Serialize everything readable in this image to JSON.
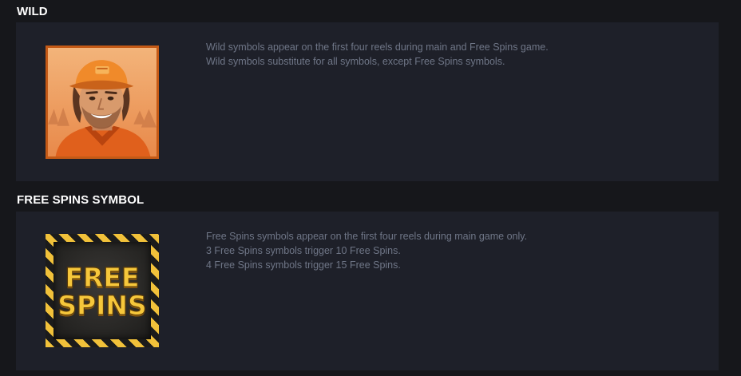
{
  "sections": {
    "wild": {
      "title": "WILD",
      "lines": [
        "Wild symbols appear on the first four reels during main and Free Spins game.",
        "Wild symbols substitute for all symbols, except Free Spins symbols."
      ],
      "symbol_icon": "wild-man-portrait-icon"
    },
    "free_spins": {
      "title": "FREE SPINS SYMBOL",
      "lines": [
        "Free Spins symbols appear on the first four reels during main game only.",
        "3 Free Spins symbols trigger 10 Free Spins.",
        "4 Free Spins symbols trigger 15 Free Spins."
      ],
      "symbol_text_line1": "FREE",
      "symbol_text_line2": "SPINS",
      "symbol_icon": "free-spins-symbol-icon"
    }
  },
  "colors": {
    "background": "#16171b",
    "panel": "#1e2029",
    "description_text": "#6f7687",
    "title_text": "#ffffff",
    "free_spins_gold": "#f6c73b",
    "wild_frame": "#c55a16"
  }
}
